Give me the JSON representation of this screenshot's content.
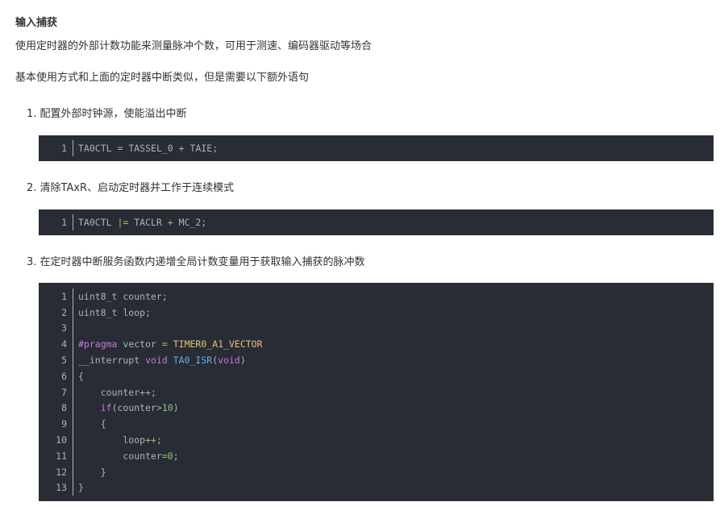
{
  "heading": "输入捕获",
  "intro": "使用定时器的外部计数功能来测量脉冲个数，可用于测速、编码器驱动等场合",
  "para2": "基本使用方式和上面的定时器中断类似，但是需要以下额外语句",
  "steps": [
    {
      "label": "1. 配置外部时钟源，使能溢出中断",
      "code": [
        {
          "n": "1",
          "tokens": [
            [
              "plain",
              "TA0CTL "
            ],
            [
              "op",
              "="
            ],
            [
              "plain",
              " TASSEL_0 "
            ],
            [
              "op",
              "+"
            ],
            [
              "plain",
              " TAIE;"
            ]
          ]
        }
      ]
    },
    {
      "label": "2. 清除TAxR、启动定时器并工作于连续模式",
      "code": [
        {
          "n": "1",
          "tokens": [
            [
              "plain",
              "TA0CTL "
            ],
            [
              "op",
              "|="
            ],
            [
              "plain",
              " TACLR "
            ],
            [
              "op",
              "+"
            ],
            [
              "plain",
              " MC_2;"
            ]
          ]
        }
      ]
    },
    {
      "label": "3. 在定时器中断服务函数内递增全局计数变量用于获取输入捕获的脉冲数",
      "code": [
        {
          "n": "1",
          "tokens": [
            [
              "plain",
              "uint8_t counter;"
            ]
          ]
        },
        {
          "n": "2",
          "tokens": [
            [
              "plain",
              "uint8_t loop;"
            ]
          ]
        },
        {
          "n": "3",
          "tokens": [
            [
              "plain",
              ""
            ]
          ]
        },
        {
          "n": "4",
          "tokens": [
            [
              "kw",
              "#pragma"
            ],
            [
              "plain",
              " vector "
            ],
            [
              "op",
              "="
            ],
            [
              "plain",
              " "
            ],
            [
              "macro",
              "TIMER0_A1_VECTOR"
            ]
          ]
        },
        {
          "n": "5",
          "tokens": [
            [
              "plain",
              "__interrupt "
            ],
            [
              "kw",
              "void"
            ],
            [
              "plain",
              " "
            ],
            [
              "fn",
              "TA0_ISR"
            ],
            [
              "plain",
              "("
            ],
            [
              "kw",
              "void"
            ],
            [
              "plain",
              ")"
            ]
          ]
        },
        {
          "n": "6",
          "tokens": [
            [
              "plain",
              "{"
            ]
          ]
        },
        {
          "n": "7",
          "tokens": [
            [
              "plain",
              "    counter"
            ],
            [
              "op",
              "++"
            ],
            [
              "plain",
              ";"
            ]
          ]
        },
        {
          "n": "8",
          "tokens": [
            [
              "plain",
              "    "
            ],
            [
              "kw",
              "if"
            ],
            [
              "plain",
              "(counter"
            ],
            [
              "op",
              ">"
            ],
            [
              "num",
              "10"
            ],
            [
              "plain",
              ")"
            ]
          ]
        },
        {
          "n": "9",
          "tokens": [
            [
              "plain",
              "    {"
            ]
          ]
        },
        {
          "n": "10",
          "tokens": [
            [
              "plain",
              "        loop"
            ],
            [
              "op",
              "++"
            ],
            [
              "plain",
              ";"
            ]
          ]
        },
        {
          "n": "11",
          "tokens": [
            [
              "plain",
              "        counter"
            ],
            [
              "op",
              "="
            ],
            [
              "num",
              "0"
            ],
            [
              "plain",
              ";"
            ]
          ]
        },
        {
          "n": "12",
          "tokens": [
            [
              "plain",
              "    }"
            ]
          ]
        },
        {
          "n": "13",
          "tokens": [
            [
              "plain",
              "}"
            ]
          ]
        }
      ]
    }
  ],
  "colors": {
    "code_bg": "#282c34",
    "code_text": "#abb2bf",
    "operator": "#98c379",
    "keyword": "#c678dd",
    "function": "#61afef",
    "macro": "#e5c07b"
  }
}
